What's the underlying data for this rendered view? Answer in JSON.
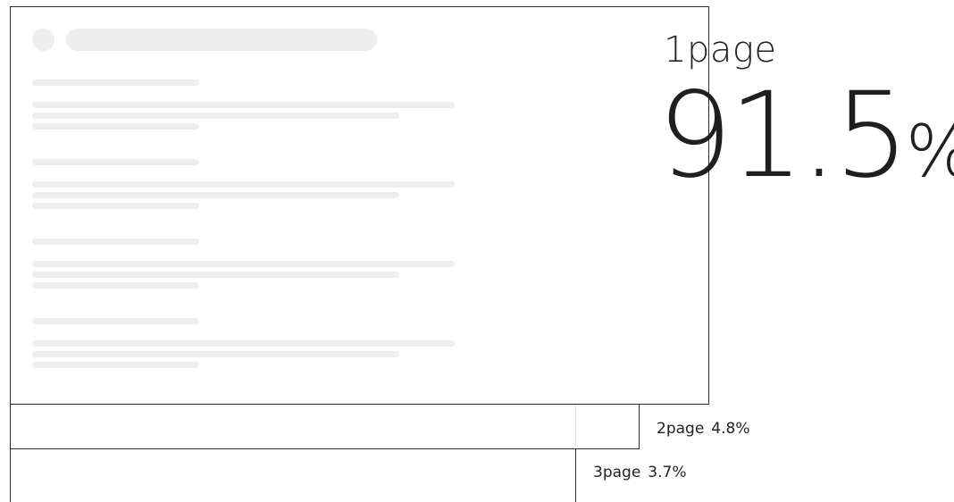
{
  "pages": [
    {
      "name": "1page",
      "value": "91.5",
      "unit": "%"
    },
    {
      "name": "2page",
      "value": "4.8%"
    },
    {
      "name": "3page",
      "value": "3.7%"
    }
  ],
  "colors": {
    "frame": "#2a2a2a",
    "skeleton": "#eeeeee",
    "text": "#222222"
  }
}
